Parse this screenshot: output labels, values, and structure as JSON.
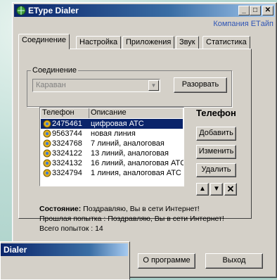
{
  "window": {
    "title": "EType Dialer",
    "company": "Компания ETайп"
  },
  "tabs": [
    "Соединение",
    "Настройка",
    "Приложения",
    "Звук",
    "Статистика"
  ],
  "connection": {
    "group_label": "Соединение",
    "combo_value": "Караван",
    "disconnect_label": "Разорвать"
  },
  "list": {
    "headers": [
      "Телефон",
      "Описание"
    ],
    "rows": [
      {
        "phone": "2475461",
        "desc": "цифровая АТС"
      },
      {
        "phone": "9563744",
        "desc": "новая линия"
      },
      {
        "phone": "3324768",
        "desc": "7 линий, аналоговая"
      },
      {
        "phone": "3324122",
        "desc": "13 линий, аналоговая"
      },
      {
        "phone": "3324132",
        "desc": "16 линий, аналоговая АТС"
      },
      {
        "phone": "3324794",
        "desc": "1 линия, аналоговая АТС"
      }
    ],
    "selected_index": 0
  },
  "phone_panel": {
    "heading": "Телефон",
    "add_label": "Добавить",
    "edit_label": "Изменить",
    "delete_label": "Удалить"
  },
  "status": {
    "state_label": "Состояние:",
    "state_text": "Поздравляю, Вы в сети Интернет!",
    "last_label": "Прошлая попытка :",
    "last_text": "Поздравляю, Вы в сети Интернет!",
    "total_label": "Всего попыток :",
    "total_value": "14"
  },
  "footer": {
    "about_label": "О программе",
    "exit_label": "Выход"
  },
  "second_window": {
    "title": "Dialer"
  },
  "colors": {
    "accent": "#0a246a",
    "company": "#2f55b5",
    "face": "#d4d0c8",
    "desktop": "#a9cfc9"
  }
}
